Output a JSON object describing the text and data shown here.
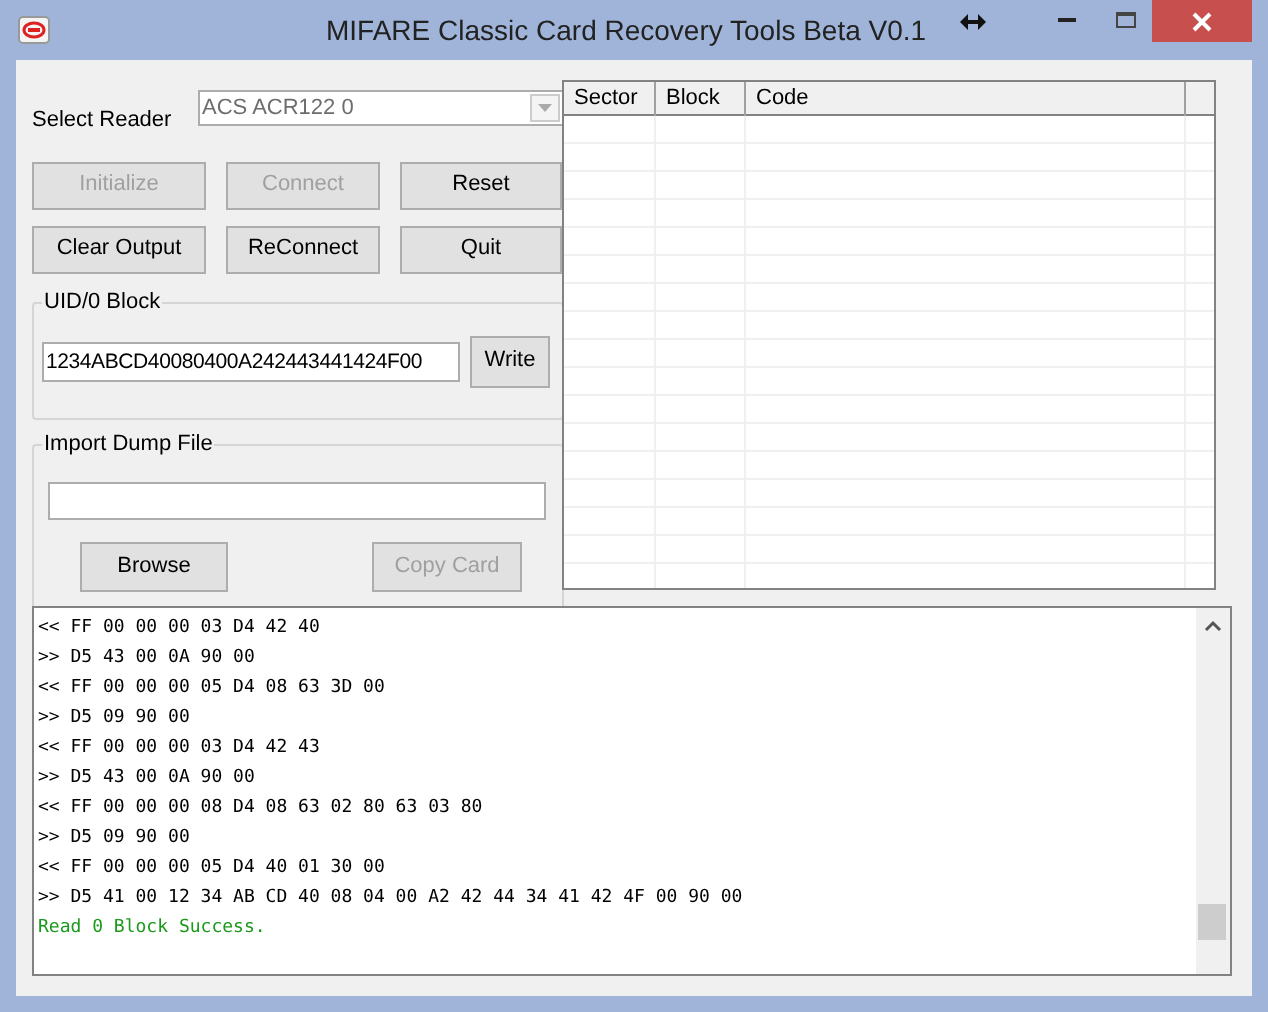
{
  "window": {
    "title": "MIFARE Classic Card Recovery Tools Beta V0.1"
  },
  "reader": {
    "label": "Select Reader",
    "value": "ACS ACR122 0"
  },
  "buttons": [
    {
      "label": "Initialize",
      "disabled": true
    },
    {
      "label": "Connect",
      "disabled": true
    },
    {
      "label": "Reset",
      "disabled": false
    },
    {
      "label": "Clear Output",
      "disabled": false
    },
    {
      "label": "ReConnect",
      "disabled": false
    },
    {
      "label": "Quit",
      "disabled": false
    }
  ],
  "uid_block": {
    "title": "UID/0 Block",
    "value": "1234ABCD40080400A242443441424F00",
    "button": {
      "label": "Write",
      "disabled": false
    }
  },
  "import_dump": {
    "title": "Import Dump File",
    "browse": {
      "label": "Browse",
      "disabled": false
    },
    "copy": {
      "label": "Copy Card",
      "disabled": true
    }
  },
  "table": {
    "columns": [
      "Sector",
      "Block",
      "Code"
    ]
  },
  "log": [
    {
      "kind": "data",
      "text": "<< FF 00 00 00 03 D4 42 40"
    },
    {
      "kind": "data",
      "text": ">> D5 43 00 0A 90 00"
    },
    {
      "kind": "data",
      "text": "<< FF 00 00 00 05 D4 08 63 3D 00"
    },
    {
      "kind": "data",
      "text": ">> D5 09 90 00"
    },
    {
      "kind": "data",
      "text": "<< FF 00 00 00 03 D4 42 43"
    },
    {
      "kind": "data",
      "text": ">> D5 43 00 0A 90 00"
    },
    {
      "kind": "data",
      "text": "<< FF 00 00 00 08 D4 08 63 02 80 63 03 80"
    },
    {
      "kind": "data",
      "text": ">> D5 09 90 00"
    },
    {
      "kind": "data",
      "text": "<< FF 00 00 00 05 D4 40 01 30 00"
    },
    {
      "kind": "data",
      "text": ">> D5 41 00 12 34 AB CD 40 08 04 00 A2 42 44 34 41 42 4F 00 90 00"
    },
    {
      "kind": "status",
      "text": "Read 0 Block Success."
    }
  ]
}
